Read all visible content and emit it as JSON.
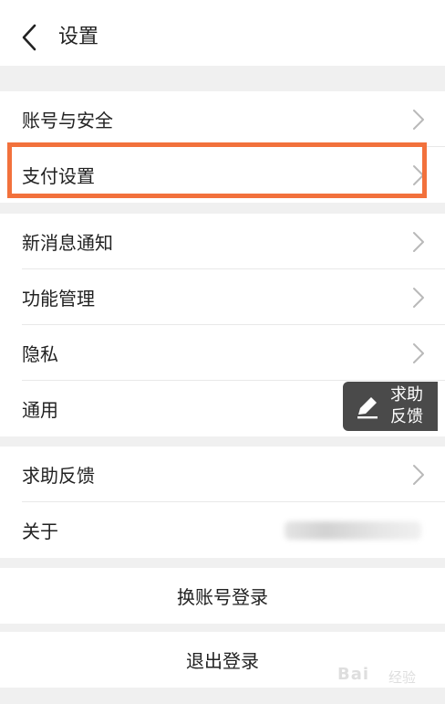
{
  "header": {
    "title": "设置"
  },
  "group1": {
    "items": [
      {
        "label": "账号与安全"
      },
      {
        "label": "支付设置"
      }
    ]
  },
  "group2": {
    "items": [
      {
        "label": "新消息通知"
      },
      {
        "label": "功能管理"
      },
      {
        "label": "隐私"
      },
      {
        "label": "通用"
      }
    ]
  },
  "group3": {
    "items": [
      {
        "label": "求助反馈"
      },
      {
        "label": "关于"
      }
    ]
  },
  "actions": {
    "switch_account": "换账号登录",
    "logout": "退出登录"
  },
  "floating_feedback": {
    "line1": "求助",
    "line2": "反馈"
  },
  "watermark": {
    "brand": "Bai",
    "site": "经验"
  },
  "colors": {
    "highlight": "#f2713c",
    "background": "#f0f0f0",
    "chevron": "#b9b9b9",
    "fab": "#4a4a4a"
  },
  "icons": {
    "back": "back-chevron-icon",
    "chevron": "chevron-right-icon",
    "fab": "pencil-edit-icon"
  }
}
